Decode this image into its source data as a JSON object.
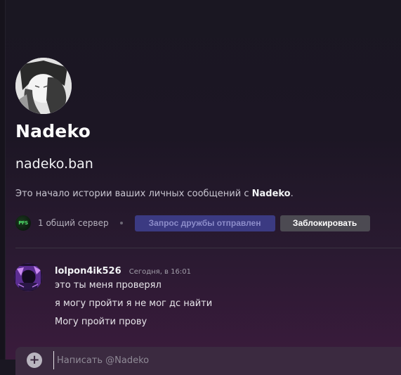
{
  "profile": {
    "display_name": "Nadeko",
    "username": "nadeko.ban",
    "intro_prefix": "Это начало истории ваших личных сообщений с ",
    "intro_name": "Nadeko",
    "intro_suffix": "."
  },
  "actions": {
    "server_icon_text": "PFS",
    "mutual_servers": "1 общий сервер",
    "friend_request_label": "Запрос дружбы отправлен",
    "block_label": "Заблокировать"
  },
  "messages": [
    {
      "author": "lolpon4ik526",
      "timestamp": "Сегодня, в 16:01",
      "lines": [
        "это ты меня проверял",
        "я могу пройти я не мог дс найти",
        "Могу пройти прову"
      ]
    }
  ],
  "composer": {
    "placeholder": "Написать @Nadeko",
    "plus_glyph": "+"
  },
  "colors": {
    "friend_button_bg": "#3b3a82",
    "block_button_bg": "#4c4a52",
    "server_icon_green": "#4fe06a"
  }
}
